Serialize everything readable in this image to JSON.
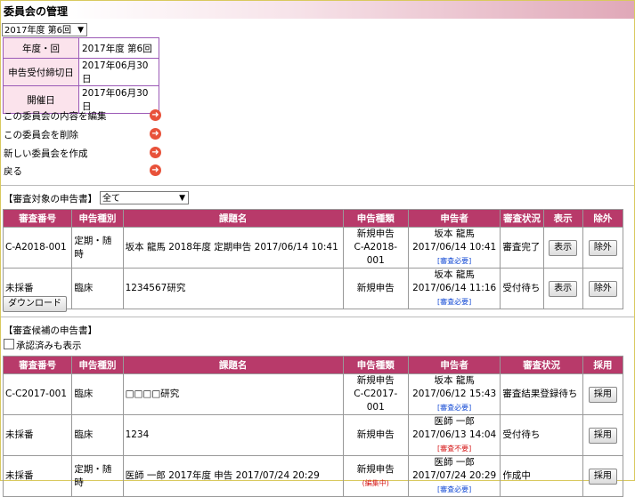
{
  "header": {
    "title": "委員会の管理"
  },
  "committee_select": {
    "value": "2017年度 第6回"
  },
  "info": [
    {
      "label": "年度・回",
      "value": "2017年度 第6回"
    },
    {
      "label": "申告受付締切日",
      "value": "2017年06月30日"
    },
    {
      "label": "開催日",
      "value": "2017年06月30日"
    }
  ],
  "actions": {
    "edit": "この委員会の内容を編集",
    "delete": "この委員会を削除",
    "create": "新しい委員会を作成",
    "back": "戻る"
  },
  "review_targets": {
    "label": "【審査対象の申告書】",
    "filter_value": "全て",
    "columns": [
      "審査番号",
      "申告種別",
      "課題名",
      "申告種類",
      "申告者",
      "審査状況",
      "表示",
      "除外"
    ],
    "rows": [
      {
        "number": "C-A2018-001",
        "category": "定期・随時",
        "title": "坂本 龍馬 2018年度 定期申告 2017/06/14 10:41",
        "type_line1": "新規申告",
        "type_line2": "C-A2018-001",
        "applicant": "坂本 龍馬",
        "date": "2017/06/14 10:41",
        "tag": "[審査必要]",
        "status": "審査完了",
        "show": "表示",
        "exclude": "除外"
      },
      {
        "number": "未採番",
        "category": "臨床",
        "title": "1234567研究",
        "type_line1": "新規申告",
        "type_line2": "",
        "applicant": "坂本 龍馬",
        "date": "2017/06/14 11:16",
        "tag": "[審査必要]",
        "status": "受付待ち",
        "show": "表示",
        "exclude": "除外"
      }
    ],
    "download": "ダウンロード"
  },
  "candidates": {
    "label": "【審査候補の申告書】",
    "show_approved": "承認済みも表示",
    "columns": [
      "審査番号",
      "申告種別",
      "課題名",
      "申告種類",
      "申告者",
      "審査状況",
      "採用"
    ],
    "rows": [
      {
        "number": "C-C2017-001",
        "category": "臨床",
        "title": "□□□□研究",
        "type_line1": "新規申告",
        "type_line2": "C-C2017-001",
        "type_tag": "",
        "applicant": "坂本 龍馬",
        "date": "2017/06/12 15:43",
        "tag": "[審査必要]",
        "tag_color": "blue",
        "status": "審査結果登録待ち",
        "adopt": "採用"
      },
      {
        "number": "未採番",
        "category": "臨床",
        "title": "1234",
        "type_line1": "新規申告",
        "type_line2": "",
        "type_tag": "",
        "applicant": "医師 一郎",
        "date": "2017/06/13 14:04",
        "tag": "[審査不要]",
        "tag_color": "red",
        "status": "受付待ち",
        "adopt": "採用"
      },
      {
        "number": "未採番",
        "category": "定期・随時",
        "title": "医師 一郎 2017年度 申告 2017/07/24 20:29",
        "type_line1": "新規申告",
        "type_line2": "",
        "type_tag": "(編集中)",
        "applicant": "医師 一郎",
        "date": "2017/07/24 20:29",
        "tag": "[審査必要]",
        "tag_color": "blue",
        "status": "作成中",
        "adopt": "採用"
      }
    ]
  }
}
